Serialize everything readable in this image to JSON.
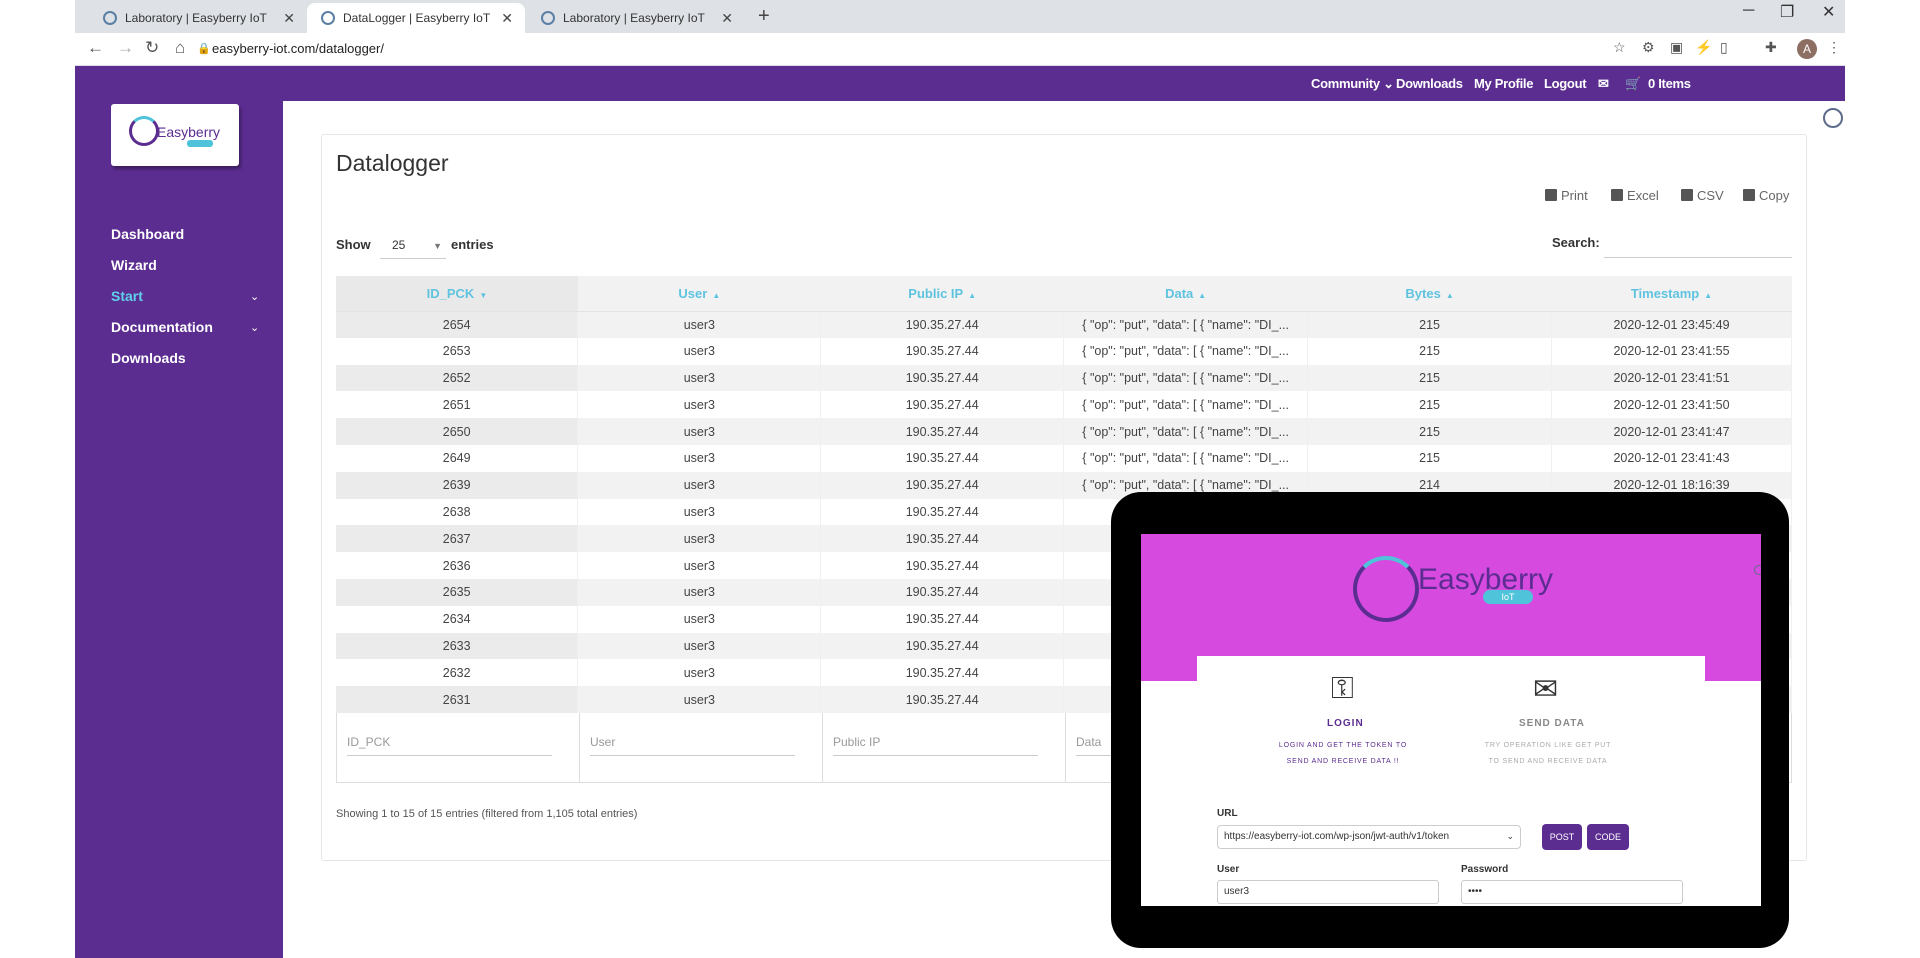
{
  "browser": {
    "tabs": [
      {
        "label": "Laboratory | Easyberry IoT"
      },
      {
        "label": "DataLogger | Easyberry IoT"
      },
      {
        "label": "Laboratory | Easyberry IoT"
      }
    ],
    "url": "easyberry-iot.com/datalogger/",
    "avatar_letter": "A"
  },
  "topnav": {
    "community": "Community",
    "downloads": "Downloads",
    "my_profile": "My Profile",
    "logout": "Logout",
    "cart": "0 Items"
  },
  "sidebar": {
    "logo_text": "Easyberry",
    "items": [
      {
        "label": "Dashboard"
      },
      {
        "label": "Wizard"
      },
      {
        "label": "Start"
      },
      {
        "label": "Documentation"
      },
      {
        "label": "Downloads"
      }
    ]
  },
  "main": {
    "title": "Datalogger",
    "export": {
      "print": "Print",
      "excel": "Excel",
      "csv": "CSV",
      "copy": "Copy"
    },
    "show_label": "Show",
    "page_length": "25",
    "entries_label": "entries",
    "search_label": "Search:",
    "columns": [
      "ID_PCK",
      "User",
      "Public IP",
      "Data",
      "Bytes",
      "Timestamp"
    ],
    "rows": [
      [
        "2654",
        "user3",
        "190.35.27.44",
        "{ \"op\": \"put\", \"data\": [ { \"name\": \"DI_...",
        "215",
        "2020-12-01 23:45:49"
      ],
      [
        "2653",
        "user3",
        "190.35.27.44",
        "{ \"op\": \"put\", \"data\": [ { \"name\": \"DI_...",
        "215",
        "2020-12-01 23:41:55"
      ],
      [
        "2652",
        "user3",
        "190.35.27.44",
        "{ \"op\": \"put\", \"data\": [ { \"name\": \"DI_...",
        "215",
        "2020-12-01 23:41:51"
      ],
      [
        "2651",
        "user3",
        "190.35.27.44",
        "{ \"op\": \"put\", \"data\": [ { \"name\": \"DI_...",
        "215",
        "2020-12-01 23:41:50"
      ],
      [
        "2650",
        "user3",
        "190.35.27.44",
        "{ \"op\": \"put\", \"data\": [ { \"name\": \"DI_...",
        "215",
        "2020-12-01 23:41:47"
      ],
      [
        "2649",
        "user3",
        "190.35.27.44",
        "{ \"op\": \"put\", \"data\": [ { \"name\": \"DI_...",
        "215",
        "2020-12-01 23:41:43"
      ],
      [
        "2639",
        "user3",
        "190.35.27.44",
        "{ \"op\": \"put\", \"data\": [ { \"name\": \"DI_...",
        "214",
        "2020-12-01 18:16:39"
      ],
      [
        "2638",
        "user3",
        "190.35.27.44",
        "{ \"op\":",
        "",
        ""
      ],
      [
        "2637",
        "user3",
        "190.35.27.44",
        "{ \"op\":",
        "",
        ""
      ],
      [
        "2636",
        "user3",
        "190.35.27.44",
        "{ \"op\":",
        "",
        ""
      ],
      [
        "2635",
        "user3",
        "190.35.27.44",
        "{ \"op\":",
        "",
        ""
      ],
      [
        "2634",
        "user3",
        "190.35.27.44",
        "{ \"op\":",
        "",
        ""
      ],
      [
        "2633",
        "user3",
        "190.35.27.44",
        "{ \"op\":",
        "",
        ""
      ],
      [
        "2632",
        "user3",
        "190.35.27.44",
        "{ \"op\":",
        "",
        ""
      ],
      [
        "2631",
        "user3",
        "190.35.27.44",
        "{ \"op\":",
        "",
        ""
      ]
    ],
    "filters": [
      "ID_PCK",
      "User",
      "Public IP",
      "Data"
    ],
    "info": "Showing 1 to 15 of 15 entries (filtered from 1,105 total entries)"
  },
  "overlay": {
    "logo_text": "Easyberry",
    "logo_sub": "IoT",
    "login_title": "LOGIN",
    "login_desc": "LOGIN AND GET THE TOKEN TO SEND AND RECEIVE DATA !!",
    "send_title": "SEND DATA",
    "send_desc": "TRY OPERATION LIKE GET PUT TO SEND AND RECEIVE DATA",
    "url_label": "URL",
    "url_value": "https://easyberry-iot.com/wp-json/jwt-auth/v1/token",
    "post_btn": "POST",
    "code_btn": "CODE",
    "user_label": "User",
    "user_value": "user3",
    "password_label": "Password",
    "password_value": "••••"
  },
  "colors": {
    "brand_purple": "#5c2d91",
    "accent_cyan": "#5fc3e0",
    "overlay_magenta": "#d64ae0"
  }
}
